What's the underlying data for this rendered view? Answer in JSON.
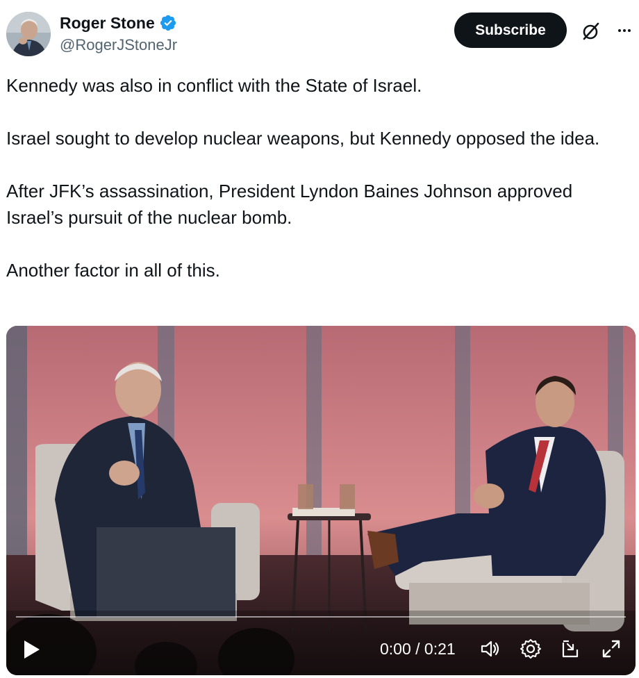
{
  "author": {
    "display_name": "Roger Stone",
    "handle": "@RogerJStoneJr",
    "verified_icon": "verified-badge-icon",
    "avatar_icon": "avatar"
  },
  "actions": {
    "subscribe_label": "Subscribe",
    "grok_icon": "grok-icon",
    "more_icon": "more-icon"
  },
  "tweet": {
    "paragraphs": [
      "Kennedy was also in conflict with the State of Israel.",
      "Israel sought to develop nuclear weapons, but Kennedy opposed the idea.",
      "After JFK’s assassination, President Lyndon Baines Johnson approved Israel’s pursuit of the nuclear bomb.",
      "Another factor in all of this."
    ]
  },
  "video": {
    "time": "0:00 / 0:21",
    "progress": 0,
    "icons": [
      "play-icon",
      "volume-icon",
      "settings-icon",
      "picture-in-picture-icon",
      "fullscreen-icon"
    ]
  },
  "colors": {
    "text": "#0f1419",
    "secondary": "#536471",
    "verified": "#1d9bf0",
    "button": "#0f1419"
  }
}
